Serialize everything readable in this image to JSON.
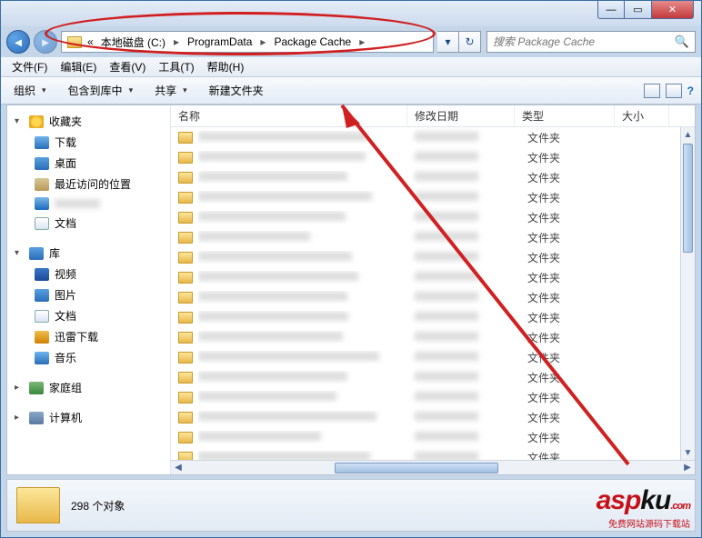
{
  "breadcrumb": {
    "prefix": "«",
    "drive": "本地磁盘 (C:)",
    "seg1": "ProgramData",
    "seg2": "Package Cache"
  },
  "search": {
    "placeholder": "搜索 Package Cache"
  },
  "menu": {
    "file": "文件(F)",
    "edit": "编辑(E)",
    "view": "查看(V)",
    "tools": "工具(T)",
    "help": "帮助(H)"
  },
  "toolbar": {
    "organize": "组织",
    "include": "包含到库中",
    "share": "共享",
    "newfolder": "新建文件夹"
  },
  "cols": {
    "name": "名称",
    "date": "修改日期",
    "type": "类型",
    "size": "大小"
  },
  "sidebar": {
    "favorites": "收藏夹",
    "downloads": "下载",
    "desktop": "桌面",
    "recent": "最近访问的位置",
    "docs": "文档",
    "libraries": "库",
    "videos": "视频",
    "pictures": "图片",
    "docs2": "文档",
    "xunlei": "迅雷下载",
    "music": "音乐",
    "homegroup": "家庭组",
    "computer": "计算机"
  },
  "rows": [
    {
      "name": "████████",
      "date": "20██/█/█",
      "type": "文件夹"
    },
    {
      "name": "████████",
      "date": "10██████",
      "type": "文件夹"
    },
    {
      "name": "████████",
      "date": "████████",
      "type": "文件夹"
    },
    {
      "name": "██████58EF",
      "date": "",
      "type": "文件夹"
    },
    {
      "name": "{████████}",
      "date": "████████",
      "type": "文件夹"
    },
    {
      "name": "████████",
      "date": "████████",
      "type": "文件夹"
    },
    {
      "name": "████████",
      "date": "████████",
      "type": "文件夹"
    },
    {
      "name": "███████3…",
      "date": "2███████",
      "type": "文件夹"
    },
    {
      "name": "██████DD…",
      "date": "████████",
      "type": "文件夹"
    },
    {
      "name": "████████",
      "date": "████████",
      "type": "文件夹"
    },
    {
      "name": "████████",
      "date": "████████",
      "type": "文件夹"
    },
    {
      "name": "{████████",
      "date": "████████",
      "type": "文件夹"
    },
    {
      "name": "███████3…",
      "date": "████████",
      "type": "文件夹"
    },
    {
      "name": "███████5…",
      "date": "2012/█/█",
      "type": "文件夹"
    },
    {
      "name": "████████",
      "date": "████████",
      "type": "文件夹"
    },
    {
      "name": "██████F0…",
      "date": "2███████",
      "type": "文件夹"
    },
    {
      "name": "████████",
      "date": "████████",
      "type": "文件夹"
    }
  ],
  "status": {
    "count": "298 个对象"
  },
  "watermark": {
    "domain": ".com",
    "tagline": "免费网站源码下载站"
  }
}
